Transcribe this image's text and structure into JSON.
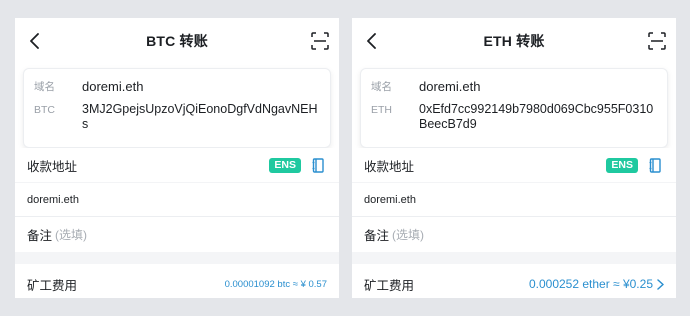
{
  "screens": [
    {
      "title": "BTC 转账",
      "info": {
        "domain_key": "域名",
        "domain_value": "doremi.eth",
        "addr_key": "BTC",
        "addr_value": "3MJ2GpejsUpzoVjQiEonoDgfVdNgavNEHs"
      },
      "address_label": "收款地址",
      "ens_badge": "ENS",
      "address_value": "doremi.eth",
      "memo_label": "备注",
      "memo_placeholder": "(选填)",
      "fee_label": "矿工费用",
      "fee_value": "0.00001092 btc ≈ ¥ 0.57"
    },
    {
      "title": "ETH 转账",
      "info": {
        "domain_key": "域名",
        "domain_value": "doremi.eth",
        "addr_key": "ETH",
        "addr_value": "0xEfd7cc992149b7980d069Cbc955F0310BeecB7d9"
      },
      "address_label": "收款地址",
      "ens_badge": "ENS",
      "address_value": "doremi.eth",
      "memo_label": "备注",
      "memo_placeholder": "(选填)",
      "fee_label": "矿工费用",
      "fee_value": "0.000252 ether ≈ ¥0.25"
    }
  ],
  "colors": {
    "accent_teal": "#1fc9a0",
    "link_blue": "#2a8fcf",
    "background": "#e4e6ea"
  },
  "icons": [
    "back-arrow-icon",
    "scan-icon",
    "address-book-icon",
    "chevron-right-icon"
  ]
}
